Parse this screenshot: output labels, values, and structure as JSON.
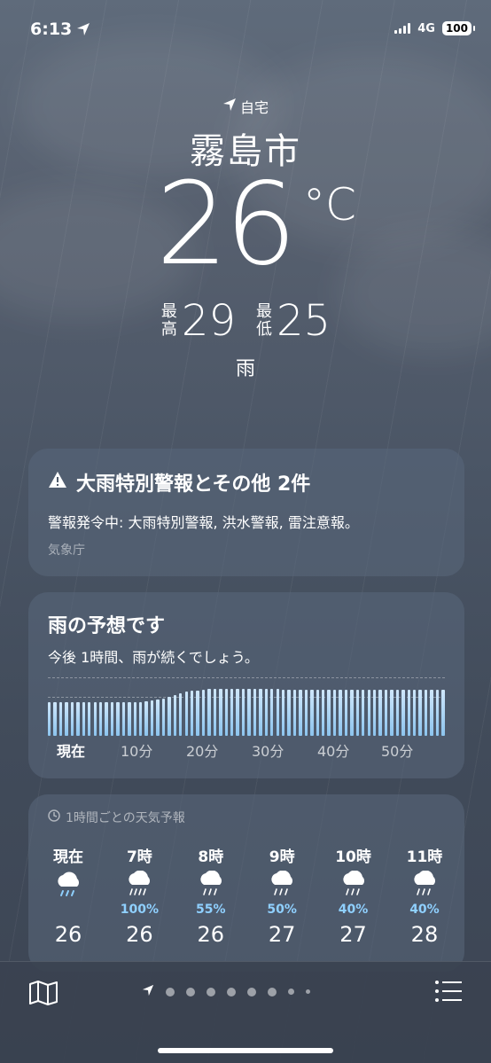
{
  "status_bar": {
    "time": "6:13",
    "network": "4G",
    "battery": "100"
  },
  "location": {
    "home_label": "自宅",
    "city": "霧島市",
    "temperature": "26",
    "unit": "°C",
    "high_label": "最高",
    "high": "29",
    "low_label": "最低",
    "low": "25",
    "condition": "雨"
  },
  "alert": {
    "title": "大雨特別警報とその他 2件",
    "body": "警報発令中: 大雨特別警報, 洪水警報, 雷注意報。",
    "source": "気象庁"
  },
  "precip": {
    "title": "雨の予想です",
    "subtitle": "今後 1時間、雨が続くでしょう。",
    "ticks": [
      "現在",
      "10分",
      "20分",
      "30分",
      "40分",
      "50分"
    ],
    "intensity": [
      0.58,
      0.58,
      0.58,
      0.58,
      0.58,
      0.58,
      0.58,
      0.58,
      0.58,
      0.58,
      0.58,
      0.58,
      0.58,
      0.58,
      0.58,
      0.58,
      0.58,
      0.59,
      0.6,
      0.62,
      0.64,
      0.67,
      0.7,
      0.73,
      0.75,
      0.77,
      0.78,
      0.79,
      0.8,
      0.8,
      0.81,
      0.81,
      0.81,
      0.81,
      0.81,
      0.8,
      0.8,
      0.8,
      0.8,
      0.8,
      0.8,
      0.79,
      0.79,
      0.79,
      0.79,
      0.79,
      0.79,
      0.79,
      0.79,
      0.79,
      0.79,
      0.79,
      0.79,
      0.79,
      0.79,
      0.79,
      0.79,
      0.79,
      0.79,
      0.79,
      0.79,
      0.79,
      0.79,
      0.79,
      0.79,
      0.79,
      0.79,
      0.79,
      0.79,
      0.79
    ]
  },
  "hourly": {
    "title": "1時間ごとの天気予報",
    "items": [
      {
        "time": "現在",
        "icon": "cloud-rain-icon",
        "prob": "",
        "temp": "26"
      },
      {
        "time": "7時",
        "icon": "cloud-heavy-rain-icon",
        "prob": "100%",
        "temp": "26"
      },
      {
        "time": "8時",
        "icon": "cloud-rain-icon",
        "prob": "55%",
        "temp": "26"
      },
      {
        "time": "9時",
        "icon": "cloud-rain-icon",
        "prob": "50%",
        "temp": "27"
      },
      {
        "time": "10時",
        "icon": "cloud-rain-icon",
        "prob": "40%",
        "temp": "27"
      },
      {
        "time": "11時",
        "icon": "cloud-rain-icon",
        "prob": "40%",
        "temp": "28"
      }
    ]
  },
  "colors": {
    "accent_precip": "#8fd0ff",
    "bar": "#a9d4f5"
  }
}
